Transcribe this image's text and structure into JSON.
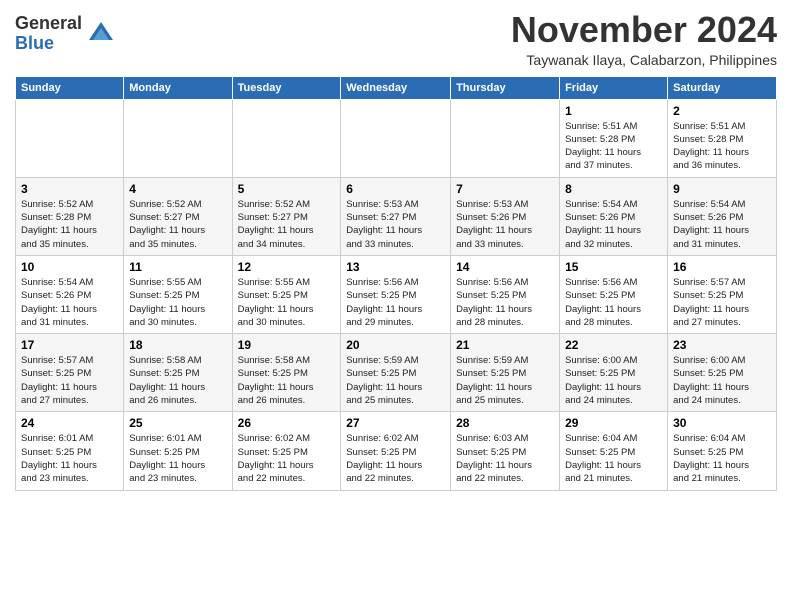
{
  "header": {
    "logo_general": "General",
    "logo_blue": "Blue",
    "month_title": "November 2024",
    "subtitle": "Taywanak Ilaya, Calabarzon, Philippines"
  },
  "weekdays": [
    "Sunday",
    "Monday",
    "Tuesday",
    "Wednesday",
    "Thursday",
    "Friday",
    "Saturday"
  ],
  "weeks": [
    [
      {
        "day": "",
        "info": ""
      },
      {
        "day": "",
        "info": ""
      },
      {
        "day": "",
        "info": ""
      },
      {
        "day": "",
        "info": ""
      },
      {
        "day": "",
        "info": ""
      },
      {
        "day": "1",
        "info": "Sunrise: 5:51 AM\nSunset: 5:28 PM\nDaylight: 11 hours\nand 37 minutes."
      },
      {
        "day": "2",
        "info": "Sunrise: 5:51 AM\nSunset: 5:28 PM\nDaylight: 11 hours\nand 36 minutes."
      }
    ],
    [
      {
        "day": "3",
        "info": "Sunrise: 5:52 AM\nSunset: 5:28 PM\nDaylight: 11 hours\nand 35 minutes."
      },
      {
        "day": "4",
        "info": "Sunrise: 5:52 AM\nSunset: 5:27 PM\nDaylight: 11 hours\nand 35 minutes."
      },
      {
        "day": "5",
        "info": "Sunrise: 5:52 AM\nSunset: 5:27 PM\nDaylight: 11 hours\nand 34 minutes."
      },
      {
        "day": "6",
        "info": "Sunrise: 5:53 AM\nSunset: 5:27 PM\nDaylight: 11 hours\nand 33 minutes."
      },
      {
        "day": "7",
        "info": "Sunrise: 5:53 AM\nSunset: 5:26 PM\nDaylight: 11 hours\nand 33 minutes."
      },
      {
        "day": "8",
        "info": "Sunrise: 5:54 AM\nSunset: 5:26 PM\nDaylight: 11 hours\nand 32 minutes."
      },
      {
        "day": "9",
        "info": "Sunrise: 5:54 AM\nSunset: 5:26 PM\nDaylight: 11 hours\nand 31 minutes."
      }
    ],
    [
      {
        "day": "10",
        "info": "Sunrise: 5:54 AM\nSunset: 5:26 PM\nDaylight: 11 hours\nand 31 minutes."
      },
      {
        "day": "11",
        "info": "Sunrise: 5:55 AM\nSunset: 5:25 PM\nDaylight: 11 hours\nand 30 minutes."
      },
      {
        "day": "12",
        "info": "Sunrise: 5:55 AM\nSunset: 5:25 PM\nDaylight: 11 hours\nand 30 minutes."
      },
      {
        "day": "13",
        "info": "Sunrise: 5:56 AM\nSunset: 5:25 PM\nDaylight: 11 hours\nand 29 minutes."
      },
      {
        "day": "14",
        "info": "Sunrise: 5:56 AM\nSunset: 5:25 PM\nDaylight: 11 hours\nand 28 minutes."
      },
      {
        "day": "15",
        "info": "Sunrise: 5:56 AM\nSunset: 5:25 PM\nDaylight: 11 hours\nand 28 minutes."
      },
      {
        "day": "16",
        "info": "Sunrise: 5:57 AM\nSunset: 5:25 PM\nDaylight: 11 hours\nand 27 minutes."
      }
    ],
    [
      {
        "day": "17",
        "info": "Sunrise: 5:57 AM\nSunset: 5:25 PM\nDaylight: 11 hours\nand 27 minutes."
      },
      {
        "day": "18",
        "info": "Sunrise: 5:58 AM\nSunset: 5:25 PM\nDaylight: 11 hours\nand 26 minutes."
      },
      {
        "day": "19",
        "info": "Sunrise: 5:58 AM\nSunset: 5:25 PM\nDaylight: 11 hours\nand 26 minutes."
      },
      {
        "day": "20",
        "info": "Sunrise: 5:59 AM\nSunset: 5:25 PM\nDaylight: 11 hours\nand 25 minutes."
      },
      {
        "day": "21",
        "info": "Sunrise: 5:59 AM\nSunset: 5:25 PM\nDaylight: 11 hours\nand 25 minutes."
      },
      {
        "day": "22",
        "info": "Sunrise: 6:00 AM\nSunset: 5:25 PM\nDaylight: 11 hours\nand 24 minutes."
      },
      {
        "day": "23",
        "info": "Sunrise: 6:00 AM\nSunset: 5:25 PM\nDaylight: 11 hours\nand 24 minutes."
      }
    ],
    [
      {
        "day": "24",
        "info": "Sunrise: 6:01 AM\nSunset: 5:25 PM\nDaylight: 11 hours\nand 23 minutes."
      },
      {
        "day": "25",
        "info": "Sunrise: 6:01 AM\nSunset: 5:25 PM\nDaylight: 11 hours\nand 23 minutes."
      },
      {
        "day": "26",
        "info": "Sunrise: 6:02 AM\nSunset: 5:25 PM\nDaylight: 11 hours\nand 22 minutes."
      },
      {
        "day": "27",
        "info": "Sunrise: 6:02 AM\nSunset: 5:25 PM\nDaylight: 11 hours\nand 22 minutes."
      },
      {
        "day": "28",
        "info": "Sunrise: 6:03 AM\nSunset: 5:25 PM\nDaylight: 11 hours\nand 22 minutes."
      },
      {
        "day": "29",
        "info": "Sunrise: 6:04 AM\nSunset: 5:25 PM\nDaylight: 11 hours\nand 21 minutes."
      },
      {
        "day": "30",
        "info": "Sunrise: 6:04 AM\nSunset: 5:25 PM\nDaylight: 11 hours\nand 21 minutes."
      }
    ]
  ]
}
